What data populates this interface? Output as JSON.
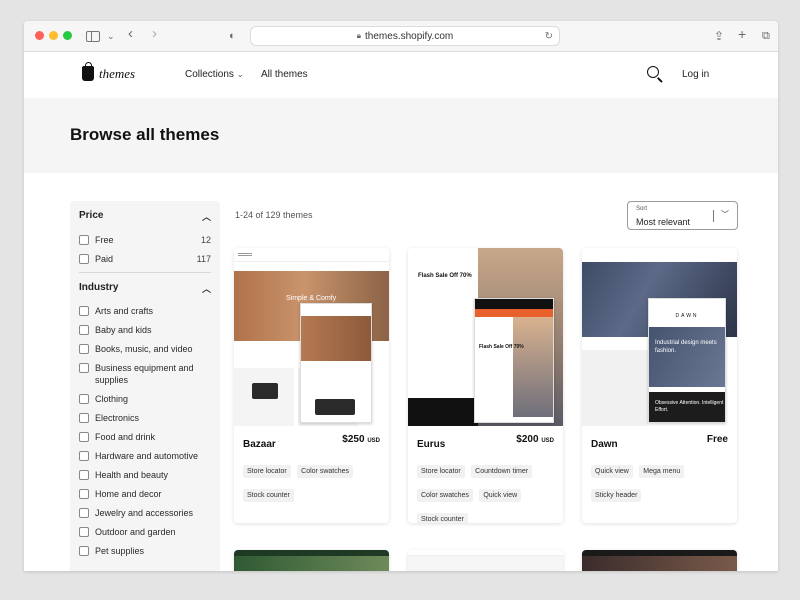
{
  "browser": {
    "url": "themes.shopify.com",
    "icons": [
      "sidebar-icon",
      "chevron-down-icon",
      "back-icon",
      "forward-icon",
      "shield-icon",
      "lock-icon",
      "reload-icon",
      "share-icon",
      "new-tab-icon",
      "tabs-icon"
    ]
  },
  "header": {
    "logo_text": "themes",
    "nav": {
      "collections": "Collections",
      "all_themes": "All themes"
    },
    "login": "Log in"
  },
  "hero": {
    "title": "Browse all themes"
  },
  "filters": {
    "price": {
      "title": "Price",
      "options": [
        {
          "label": "Free",
          "count": "12"
        },
        {
          "label": "Paid",
          "count": "117"
        }
      ]
    },
    "industry": {
      "title": "Industry",
      "options": [
        "Arts and crafts",
        "Baby and kids",
        "Books, music, and video",
        "Business equipment and supplies",
        "Clothing",
        "Electronics",
        "Food and drink",
        "Hardware and automotive",
        "Health and beauty",
        "Home and decor",
        "Jewelry and accessories",
        "Outdoor and garden",
        "Pet supplies"
      ]
    }
  },
  "results": {
    "count_text": "1-24 of 129 themes",
    "sort": {
      "label": "Sort",
      "value": "Most relevant"
    }
  },
  "themes": [
    {
      "name": "Bazaar",
      "price": "$250",
      "currency": "USD",
      "tags": [
        "Store locator",
        "Color swatches",
        "Stock counter"
      ],
      "preview_text": "Simple & Comfy"
    },
    {
      "name": "Eurus",
      "price": "$200",
      "currency": "USD",
      "tags": [
        "Store locator",
        "Countdown timer",
        "Color swatches",
        "Quick view",
        "Stock counter"
      ],
      "preview_text": "Flash Sale Off 70%"
    },
    {
      "name": "Dawn",
      "price": "Free",
      "currency": "",
      "tags": [
        "Quick view",
        "Mega menu",
        "Sticky header"
      ],
      "preview_logo": "DAWN",
      "preview_text": "Industrial design meets fashion.",
      "preview_footer": "Obsessive Attention. Intelligent Effort."
    }
  ],
  "colors": {
    "hero_bg": "#f5f5f5",
    "filter_bg": "#f5f5f5",
    "text": "#1a1a1a"
  }
}
